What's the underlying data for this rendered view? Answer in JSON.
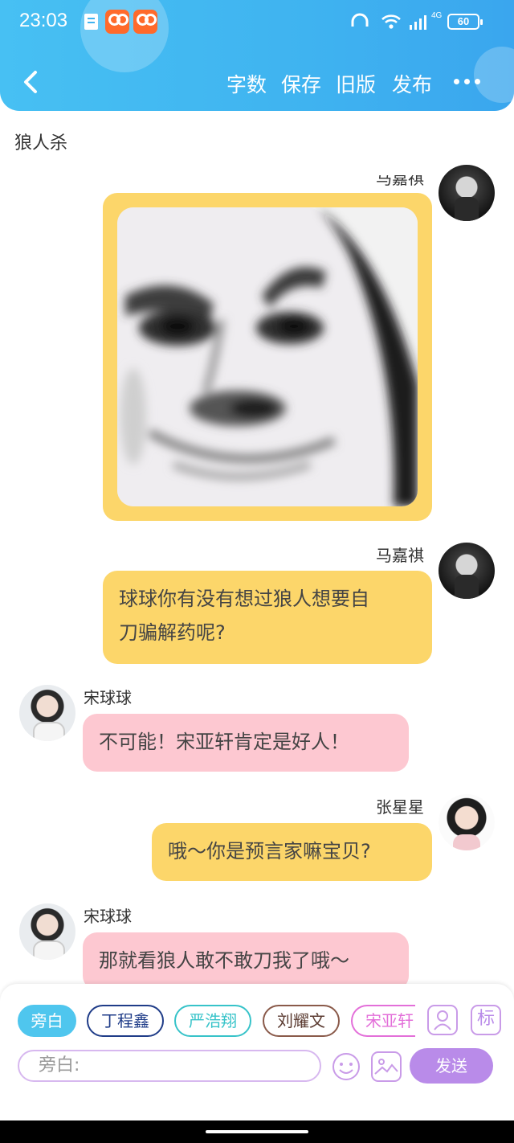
{
  "status_bar": {
    "time": "23:03",
    "network": "4G",
    "battery": "60"
  },
  "nav": {
    "word_count": "字数",
    "save": "保存",
    "old_version": "旧版",
    "publish": "发布"
  },
  "page_title": "狼人杀",
  "messages": [
    {
      "speaker": "马嘉祺",
      "type": "image",
      "side": "right",
      "avatar": "dark"
    },
    {
      "speaker": "马嘉祺",
      "type": "text",
      "side": "right",
      "avatar": "dark",
      "text_line1": "球球你有没有想过狼人想要自",
      "text_line2": "刀骗解药呢?"
    },
    {
      "speaker": "宋球球",
      "type": "text",
      "side": "left",
      "avatar": "light",
      "text": "不可能！宋亚轩肯定是好人！"
    },
    {
      "speaker": "张星星",
      "type": "text",
      "side": "right",
      "avatar": "girl",
      "text": "哦～你是预言家嘛宝贝?"
    },
    {
      "speaker": "宋球球",
      "type": "text",
      "side": "left",
      "avatar": "light",
      "text": "那就看狼人敢不敢刀我了哦～"
    }
  ],
  "character_chips": [
    {
      "label": "旁白",
      "active": true,
      "color": "#4fc6ee"
    },
    {
      "label": "丁程鑫",
      "active": false,
      "color": "#1f3c88"
    },
    {
      "label": "严浩翔",
      "active": false,
      "color": "#37c3c9"
    },
    {
      "label": "刘耀文",
      "active": false,
      "color": "#8a5a4a"
    },
    {
      "label": "宋亚轩",
      "active": false,
      "color": "#e36fd9"
    }
  ],
  "tools": {
    "mark_label": "标"
  },
  "input": {
    "placeholder": "旁白:",
    "send_label": "发送"
  },
  "icons": [
    "back-chevron-icon",
    "more-icon",
    "person-icon",
    "emoji-icon",
    "image-icon"
  ],
  "colors": {
    "header": "#3fb3f0",
    "bubble_yellow": "#fcd66a",
    "bubble_pink": "#fdc8d1",
    "send": "#b98be9"
  }
}
